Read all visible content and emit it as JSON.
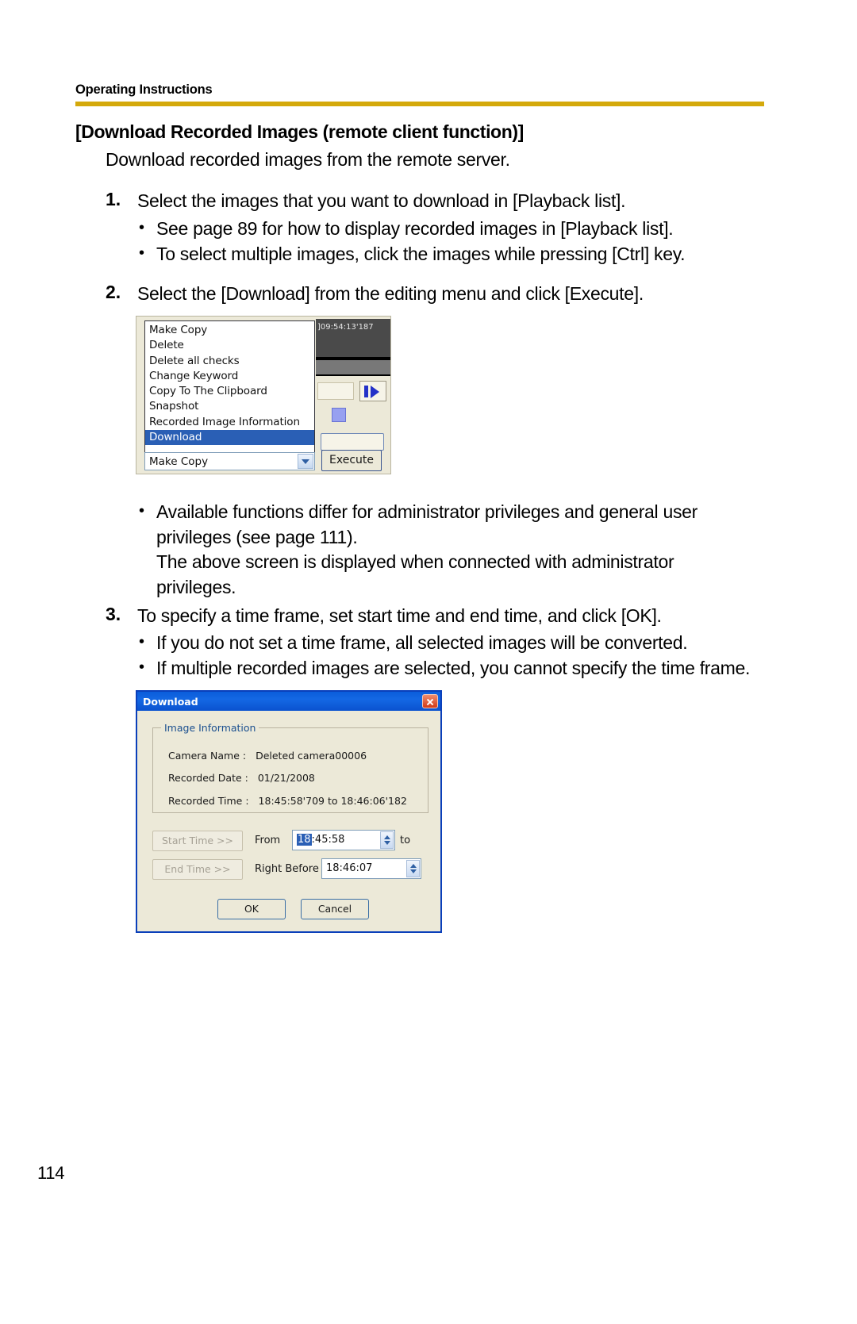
{
  "header": {
    "title": "Operating Instructions",
    "rule_color": "#d4a90b"
  },
  "section": {
    "heading": "[Download Recorded Images (remote client function)]",
    "subtitle": "Download recorded images from the remote server."
  },
  "steps": [
    {
      "number": "1.",
      "text": "Select the images that you want to download in [Playback list].",
      "bullets": [
        "See page 89 for how to display recorded images in [Playback list].",
        "To select multiple images, click the images while pressing [Ctrl] key."
      ]
    },
    {
      "number": "2.",
      "text": "Select the [Download] from the editing menu and click [Execute].",
      "bullets": []
    },
    {
      "number": "3.",
      "text": "To specify a time frame, set start time and end time, and click [OK].",
      "bullets": [
        "If you do not set a time frame, all selected images will be converted.",
        "If multiple recorded images are selected, you cannot specify the time frame."
      ]
    }
  ],
  "note_bullet": {
    "line1": "Available functions differ for administrator privileges and general user",
    "line2": "privileges (see page 111).",
    "line3": "The above screen is displayed when connected with administrator",
    "line4": "privileges."
  },
  "bullet_glyph": "•",
  "menu_screenshot": {
    "items": [
      {
        "label": "Make Copy",
        "selected": false
      },
      {
        "label": "Delete",
        "selected": false
      },
      {
        "label": "Delete all checks",
        "selected": false
      },
      {
        "label": "Change Keyword",
        "selected": false
      },
      {
        "label": "Copy To The Clipboard",
        "selected": false
      },
      {
        "label": "Snapshot",
        "selected": false
      },
      {
        "label": "Recorded Image Information",
        "selected": false
      },
      {
        "label": "Download",
        "selected": true
      }
    ],
    "combo_value": "Make Copy",
    "execute_label": "Execute",
    "viewer_timecode": "]09:54:13'187",
    "selected_bg": "#2a5fb5"
  },
  "download_dialog": {
    "title": "Download",
    "group_legend": "Image Information",
    "camera_name_label": "Camera Name :",
    "camera_name_value": "Deleted camera00006",
    "recorded_date_label": "Recorded Date :",
    "recorded_date_value": "01/21/2008",
    "recorded_time_label": "Recorded Time :",
    "recorded_time_value": "18:45:58'709   to   18:46:06'182",
    "start_time_button": "Start Time >>",
    "end_time_button": "End Time >>",
    "from_label": "From",
    "to_label": "to",
    "right_before_label": "Right Before",
    "from_value_selected": "18",
    "from_value_rest": ":45:58",
    "right_before_value": "18:46:07",
    "ok_label": "OK",
    "cancel_label": "Cancel",
    "titlebar_color": "#0a5ddb",
    "close_color": "#d23a17"
  },
  "page_number": "114"
}
